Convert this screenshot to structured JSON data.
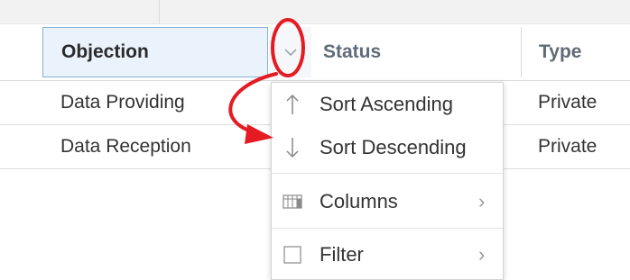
{
  "table": {
    "columns": {
      "objection": "Objection",
      "status": "Status",
      "type": "Type"
    },
    "rows": [
      {
        "objection": "Data Providing",
        "type": "Private"
      },
      {
        "objection": "Data Reception",
        "type": "Private"
      }
    ]
  },
  "menu": {
    "items": [
      {
        "label": "Sort Ascending",
        "icon": "arrow-up-icon"
      },
      {
        "label": "Sort Descending",
        "icon": "arrow-down-icon"
      },
      {
        "label": "Columns",
        "icon": "columns-icon",
        "has_submenu": true
      },
      {
        "label": "Filter",
        "icon": "checkbox-icon",
        "has_submenu": true
      }
    ]
  },
  "annotation": {
    "color": "#e51b24"
  },
  "colors": {
    "header_active_bg": "#eaf2fb",
    "header_active_border": "#8bb0d6",
    "text": "#333333"
  }
}
